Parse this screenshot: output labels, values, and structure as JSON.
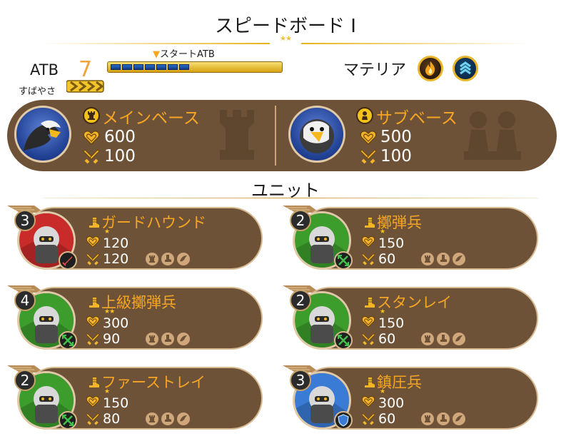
{
  "header": {
    "title": "スピードボード I",
    "stars": "★★"
  },
  "atb": {
    "label": "ATB",
    "speed_label": "すばやさ",
    "value": "7",
    "start_label": "スタートATB",
    "start_fill_fraction": 0.63,
    "segments": 7
  },
  "materia": {
    "label": "マテリア",
    "items": [
      {
        "icon": "fire-materia-icon"
      },
      {
        "icon": "wind-materia-icon"
      }
    ]
  },
  "bases": [
    {
      "name": "メインベース",
      "hp": "600",
      "atk": "100",
      "badge_icon": "rook-icon",
      "portrait": "eagle-portrait"
    },
    {
      "name": "サブベース",
      "hp": "500",
      "atk": "100",
      "badge_icon": "pawn-icon",
      "portrait": "hawk-portrait"
    }
  ],
  "units_title": "ユニット",
  "units": [
    {
      "cost": "3",
      "name": "ガードハウンド",
      "stars": "★",
      "hp": "120",
      "atk": "120",
      "role_icon": "sword-role-icon",
      "color": "#c92a2a"
    },
    {
      "cost": "2",
      "name": "擲弾兵",
      "stars": "★",
      "hp": "150",
      "atk": "60",
      "role_icon": "crossed-arrows-role-icon",
      "color": "#3c9d2d"
    },
    {
      "cost": "4",
      "name": "上級擲弾兵",
      "stars": "★★",
      "hp": "300",
      "atk": "90",
      "role_icon": "crossed-arrows-role-icon",
      "color": "#3c9d2d"
    },
    {
      "cost": "2",
      "name": "スタンレイ",
      "stars": "★",
      "hp": "150",
      "atk": "60",
      "role_icon": "crossed-arrows-role-icon",
      "color": "#3c9d2d"
    },
    {
      "cost": "2",
      "name": "ファーストレイ",
      "stars": "★",
      "hp": "150",
      "atk": "80",
      "role_icon": "crossed-arrows-role-icon",
      "color": "#3c9d2d"
    },
    {
      "cost": "3",
      "name": "鎮圧兵",
      "stars": "★",
      "hp": "300",
      "atk": "60",
      "role_icon": "shield-role-icon",
      "color": "#3a7bd5"
    }
  ],
  "colors": {
    "panel": "#6e5237",
    "accent_orange": "#f6a623",
    "gold": "#f5c21b"
  }
}
